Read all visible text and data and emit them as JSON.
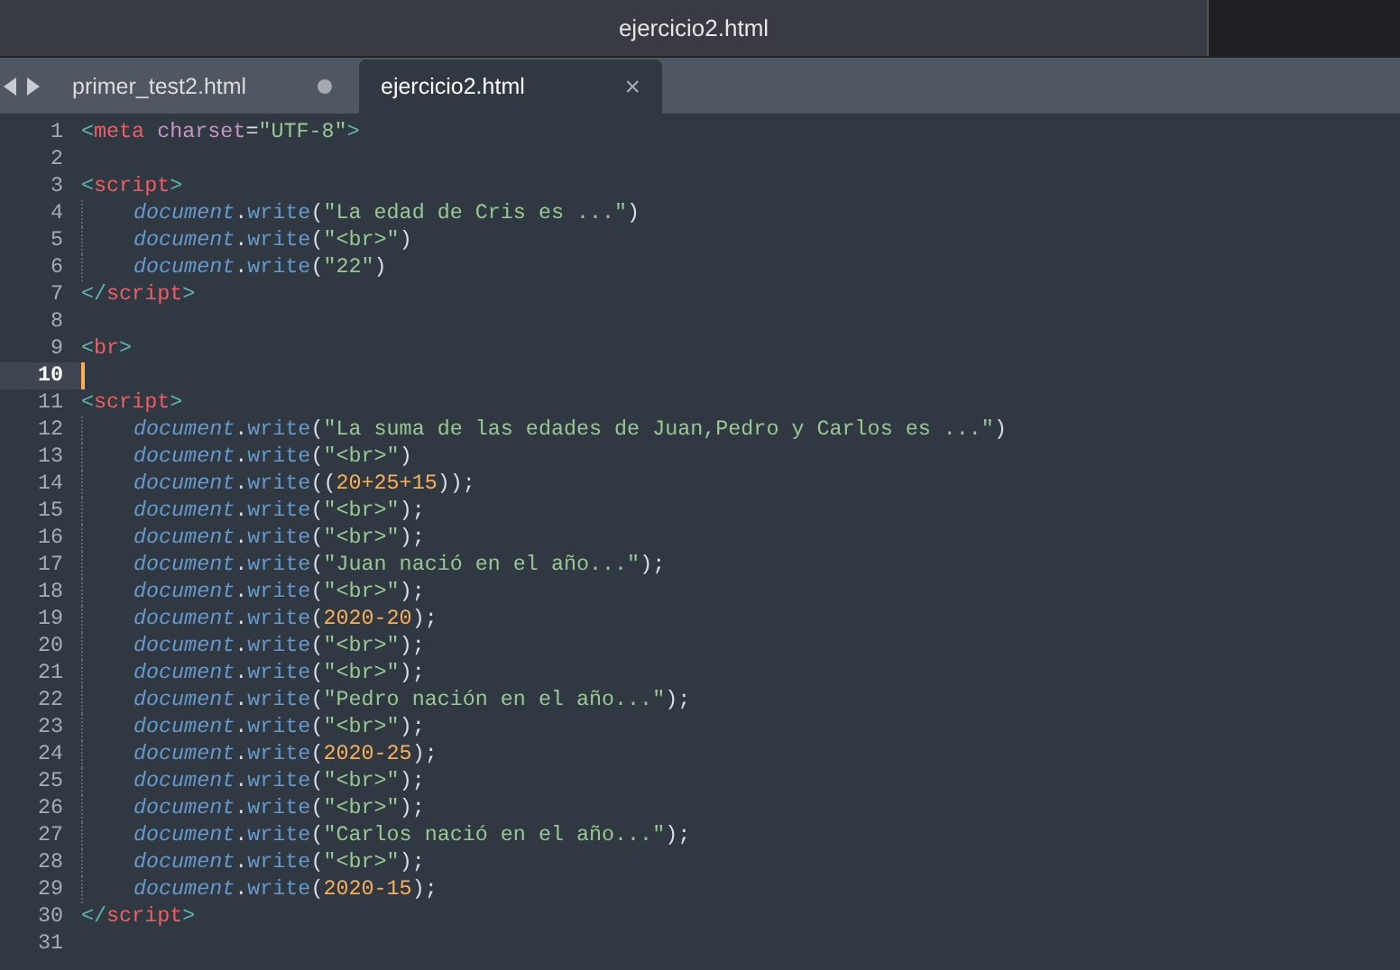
{
  "window": {
    "title": "ejercicio2.html"
  },
  "tabs": [
    {
      "label": "primer_test2.html",
      "selected": false,
      "modified": true
    },
    {
      "label": "ejercicio2.html",
      "selected": true,
      "modified": false
    }
  ],
  "tab_close": "×",
  "editor": {
    "lines": [
      {
        "number": "1",
        "current": false,
        "indented": false,
        "tokens": [
          {
            "kind": "bracket",
            "text": "<"
          },
          {
            "kind": "tag",
            "text": "meta"
          },
          {
            "kind": "attr",
            "text": " charset"
          },
          {
            "kind": "punct",
            "text": "="
          },
          {
            "kind": "string",
            "text": "\"UTF-8\""
          },
          {
            "kind": "bracket",
            "text": ">"
          }
        ]
      },
      {
        "number": "2",
        "current": false,
        "indented": false
      },
      {
        "number": "3",
        "current": false,
        "indented": false,
        "tokens": [
          {
            "kind": "bracket",
            "text": "<"
          },
          {
            "kind": "tag",
            "text": "script"
          },
          {
            "kind": "bracket",
            "text": ">"
          }
        ]
      },
      {
        "number": "4",
        "current": false,
        "indented": true,
        "tokens": [
          {
            "kind": "object",
            "text": "document"
          },
          {
            "kind": "punct",
            "text": "."
          },
          {
            "kind": "method",
            "text": "write"
          },
          {
            "kind": "punct",
            "text": "("
          },
          {
            "kind": "string",
            "text": "\"La edad de Cris es ...\""
          },
          {
            "kind": "punct",
            "text": ")"
          }
        ]
      },
      {
        "number": "5",
        "current": false,
        "indented": true,
        "tokens": [
          {
            "kind": "object",
            "text": "document"
          },
          {
            "kind": "punct",
            "text": "."
          },
          {
            "kind": "method",
            "text": "write"
          },
          {
            "kind": "punct",
            "text": "("
          },
          {
            "kind": "string",
            "text": "\"<br>\""
          },
          {
            "kind": "punct",
            "text": ")"
          }
        ]
      },
      {
        "number": "6",
        "current": false,
        "indented": true,
        "tokens": [
          {
            "kind": "object",
            "text": "document"
          },
          {
            "kind": "punct",
            "text": "."
          },
          {
            "kind": "method",
            "text": "write"
          },
          {
            "kind": "punct",
            "text": "("
          },
          {
            "kind": "string",
            "text": "\"22\""
          },
          {
            "kind": "punct",
            "text": ")"
          }
        ]
      },
      {
        "number": "7",
        "current": false,
        "indented": false,
        "tokens": [
          {
            "kind": "bracket",
            "text": "</"
          },
          {
            "kind": "tag",
            "text": "script"
          },
          {
            "kind": "bracket",
            "text": ">"
          }
        ]
      },
      {
        "number": "8",
        "current": false,
        "indented": false
      },
      {
        "number": "9",
        "current": false,
        "indented": false,
        "tokens": [
          {
            "kind": "bracket",
            "text": "<"
          },
          {
            "kind": "tag",
            "text": "br"
          },
          {
            "kind": "bracket",
            "text": ">"
          }
        ]
      },
      {
        "number": "10",
        "current": true,
        "indented": false
      },
      {
        "number": "11",
        "current": false,
        "indented": false,
        "tokens": [
          {
            "kind": "bracket",
            "text": "<"
          },
          {
            "kind": "tag",
            "text": "script"
          },
          {
            "kind": "bracket",
            "text": ">"
          }
        ]
      },
      {
        "number": "12",
        "current": false,
        "indented": true,
        "tokens": [
          {
            "kind": "object",
            "text": "document"
          },
          {
            "kind": "punct",
            "text": "."
          },
          {
            "kind": "method",
            "text": "write"
          },
          {
            "kind": "punct",
            "text": "("
          },
          {
            "kind": "string",
            "text": "\"La suma de las edades de Juan,Pedro y Carlos es ...\""
          },
          {
            "kind": "punct",
            "text": ")"
          }
        ]
      },
      {
        "number": "13",
        "current": false,
        "indented": true,
        "tokens": [
          {
            "kind": "object",
            "text": "document"
          },
          {
            "kind": "punct",
            "text": "."
          },
          {
            "kind": "method",
            "text": "write"
          },
          {
            "kind": "punct",
            "text": "("
          },
          {
            "kind": "string",
            "text": "\"<br>\""
          },
          {
            "kind": "punct",
            "text": ")"
          }
        ]
      },
      {
        "number": "14",
        "current": false,
        "indented": true,
        "tokens": [
          {
            "kind": "object",
            "text": "document"
          },
          {
            "kind": "punct",
            "text": "."
          },
          {
            "kind": "method",
            "text": "write"
          },
          {
            "kind": "punct",
            "text": "(("
          },
          {
            "kind": "number",
            "text": "20+25+15"
          },
          {
            "kind": "punct",
            "text": "));"
          }
        ]
      },
      {
        "number": "15",
        "current": false,
        "indented": true,
        "tokens": [
          {
            "kind": "object",
            "text": "document"
          },
          {
            "kind": "punct",
            "text": "."
          },
          {
            "kind": "method",
            "text": "write"
          },
          {
            "kind": "punct",
            "text": "("
          },
          {
            "kind": "string",
            "text": "\"<br>\""
          },
          {
            "kind": "punct",
            "text": ");"
          }
        ]
      },
      {
        "number": "16",
        "current": false,
        "indented": true,
        "tokens": [
          {
            "kind": "object",
            "text": "document"
          },
          {
            "kind": "punct",
            "text": "."
          },
          {
            "kind": "method",
            "text": "write"
          },
          {
            "kind": "punct",
            "text": "("
          },
          {
            "kind": "string",
            "text": "\"<br>\""
          },
          {
            "kind": "punct",
            "text": ");"
          }
        ]
      },
      {
        "number": "17",
        "current": false,
        "indented": true,
        "tokens": [
          {
            "kind": "object",
            "text": "document"
          },
          {
            "kind": "punct",
            "text": "."
          },
          {
            "kind": "method",
            "text": "write"
          },
          {
            "kind": "punct",
            "text": "("
          },
          {
            "kind": "string",
            "text": "\"Juan nació en el año...\""
          },
          {
            "kind": "punct",
            "text": ");"
          }
        ]
      },
      {
        "number": "18",
        "current": false,
        "indented": true,
        "tokens": [
          {
            "kind": "object",
            "text": "document"
          },
          {
            "kind": "punct",
            "text": "."
          },
          {
            "kind": "method",
            "text": "write"
          },
          {
            "kind": "punct",
            "text": "("
          },
          {
            "kind": "string",
            "text": "\"<br>\""
          },
          {
            "kind": "punct",
            "text": ");"
          }
        ]
      },
      {
        "number": "19",
        "current": false,
        "indented": true,
        "tokens": [
          {
            "kind": "object",
            "text": "document"
          },
          {
            "kind": "punct",
            "text": "."
          },
          {
            "kind": "method",
            "text": "write"
          },
          {
            "kind": "punct",
            "text": "("
          },
          {
            "kind": "number",
            "text": "2020-20"
          },
          {
            "kind": "punct",
            "text": ");"
          }
        ]
      },
      {
        "number": "20",
        "current": false,
        "indented": true,
        "tokens": [
          {
            "kind": "object",
            "text": "document"
          },
          {
            "kind": "punct",
            "text": "."
          },
          {
            "kind": "method",
            "text": "write"
          },
          {
            "kind": "punct",
            "text": "("
          },
          {
            "kind": "string",
            "text": "\"<br>\""
          },
          {
            "kind": "punct",
            "text": ");"
          }
        ]
      },
      {
        "number": "21",
        "current": false,
        "indented": true,
        "tokens": [
          {
            "kind": "object",
            "text": "document"
          },
          {
            "kind": "punct",
            "text": "."
          },
          {
            "kind": "method",
            "text": "write"
          },
          {
            "kind": "punct",
            "text": "("
          },
          {
            "kind": "string",
            "text": "\"<br>\""
          },
          {
            "kind": "punct",
            "text": ");"
          }
        ]
      },
      {
        "number": "22",
        "current": false,
        "indented": true,
        "tokens": [
          {
            "kind": "object",
            "text": "document"
          },
          {
            "kind": "punct",
            "text": "."
          },
          {
            "kind": "method",
            "text": "write"
          },
          {
            "kind": "punct",
            "text": "("
          },
          {
            "kind": "string",
            "text": "\"Pedro nación en el año...\""
          },
          {
            "kind": "punct",
            "text": ");"
          }
        ]
      },
      {
        "number": "23",
        "current": false,
        "indented": true,
        "tokens": [
          {
            "kind": "object",
            "text": "document"
          },
          {
            "kind": "punct",
            "text": "."
          },
          {
            "kind": "method",
            "text": "write"
          },
          {
            "kind": "punct",
            "text": "("
          },
          {
            "kind": "string",
            "text": "\"<br>\""
          },
          {
            "kind": "punct",
            "text": ");"
          }
        ]
      },
      {
        "number": "24",
        "current": false,
        "indented": true,
        "tokens": [
          {
            "kind": "object",
            "text": "document"
          },
          {
            "kind": "punct",
            "text": "."
          },
          {
            "kind": "method",
            "text": "write"
          },
          {
            "kind": "punct",
            "text": "("
          },
          {
            "kind": "number",
            "text": "2020-25"
          },
          {
            "kind": "punct",
            "text": ");"
          }
        ]
      },
      {
        "number": "25",
        "current": false,
        "indented": true,
        "tokens": [
          {
            "kind": "object",
            "text": "document"
          },
          {
            "kind": "punct",
            "text": "."
          },
          {
            "kind": "method",
            "text": "write"
          },
          {
            "kind": "punct",
            "text": "("
          },
          {
            "kind": "string",
            "text": "\"<br>\""
          },
          {
            "kind": "punct",
            "text": ");"
          }
        ]
      },
      {
        "number": "26",
        "current": false,
        "indented": true,
        "tokens": [
          {
            "kind": "object",
            "text": "document"
          },
          {
            "kind": "punct",
            "text": "."
          },
          {
            "kind": "method",
            "text": "write"
          },
          {
            "kind": "punct",
            "text": "("
          },
          {
            "kind": "string",
            "text": "\"<br>\""
          },
          {
            "kind": "punct",
            "text": ");"
          }
        ]
      },
      {
        "number": "27",
        "current": false,
        "indented": true,
        "tokens": [
          {
            "kind": "object",
            "text": "document"
          },
          {
            "kind": "punct",
            "text": "."
          },
          {
            "kind": "method",
            "text": "write"
          },
          {
            "kind": "punct",
            "text": "("
          },
          {
            "kind": "string",
            "text": "\"Carlos nació en el año...\""
          },
          {
            "kind": "punct",
            "text": ");"
          }
        ]
      },
      {
        "number": "28",
        "current": false,
        "indented": true,
        "tokens": [
          {
            "kind": "object",
            "text": "document"
          },
          {
            "kind": "punct",
            "text": "."
          },
          {
            "kind": "method",
            "text": "write"
          },
          {
            "kind": "punct",
            "text": "("
          },
          {
            "kind": "string",
            "text": "\"<br>\""
          },
          {
            "kind": "punct",
            "text": ");"
          }
        ]
      },
      {
        "number": "29",
        "current": false,
        "indented": true,
        "tokens": [
          {
            "kind": "object",
            "text": "document"
          },
          {
            "kind": "punct",
            "text": "."
          },
          {
            "kind": "method",
            "text": "write"
          },
          {
            "kind": "punct",
            "text": "("
          },
          {
            "kind": "number",
            "text": "2020-15"
          },
          {
            "kind": "punct",
            "text": ");"
          }
        ]
      },
      {
        "number": "30",
        "current": false,
        "indented": false,
        "tokens": [
          {
            "kind": "bracket",
            "text": "</"
          },
          {
            "kind": "tag",
            "text": "script"
          },
          {
            "kind": "bracket",
            "text": ">"
          }
        ]
      },
      {
        "number": "31",
        "current": false,
        "indented": false
      }
    ]
  }
}
